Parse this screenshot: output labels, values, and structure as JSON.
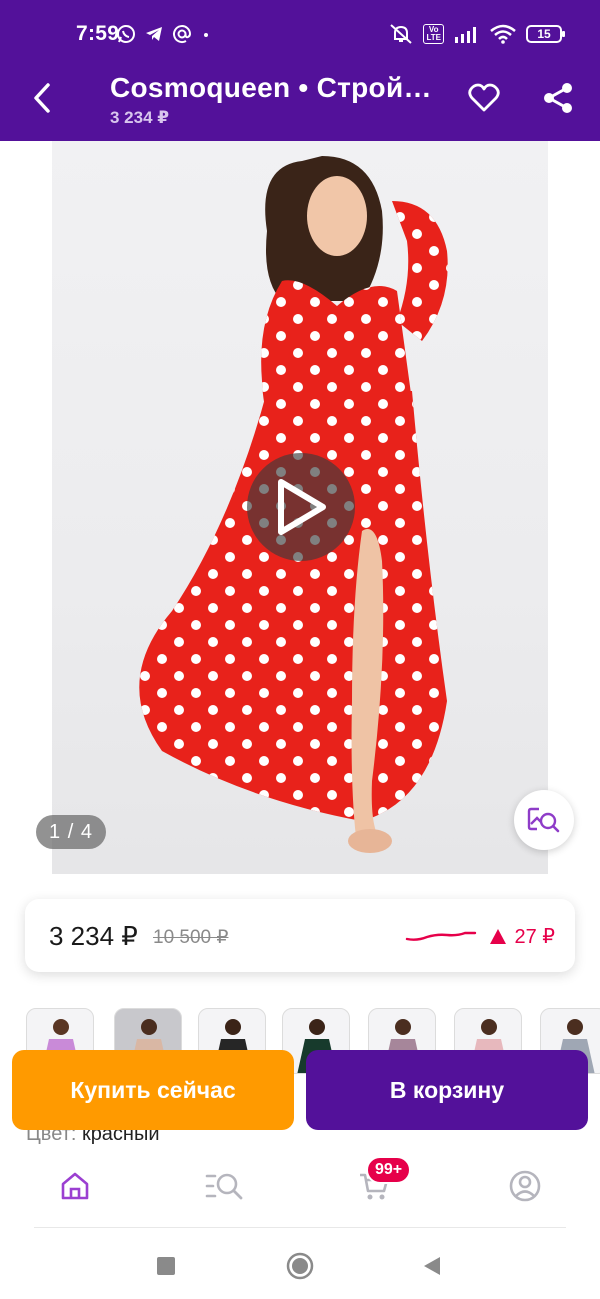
{
  "status_bar": {
    "time": "7:59",
    "volte_line1": "Vo",
    "volte_line2": "LTE",
    "battery": "15",
    "icons": [
      "whatsapp-icon",
      "telegram-icon",
      "at-icon",
      "dot-icon",
      "mute-icon",
      "volte-icon",
      "signal-icon",
      "wifi-icon",
      "battery-icon"
    ]
  },
  "app_bar": {
    "title": "Cosmoqueen • Строй…",
    "subtitle": "3 234 ₽"
  },
  "gallery": {
    "counter": "1 / 4",
    "play": "play-icon",
    "visual_search": "visual-search-icon",
    "dress_color": "#e8221b",
    "dot_color": "#ffffff"
  },
  "price": {
    "current": "3 234 ₽",
    "old": "10 500 ₽",
    "change": "27 ₽",
    "trend_color": "#e6004a"
  },
  "color": {
    "label": "Цвет:",
    "value": "красный"
  },
  "actions": {
    "buy_now": "Купить сейчас",
    "add_to_cart": "В корзину"
  },
  "bottom_nav": {
    "items": [
      "home-icon",
      "catalog-search-icon",
      "cart-icon",
      "profile-icon"
    ],
    "cart_badge": "99+"
  },
  "colors": {
    "brand": "#53119a",
    "accent_orange": "#ff9a00",
    "sale_red": "#e6004a"
  }
}
